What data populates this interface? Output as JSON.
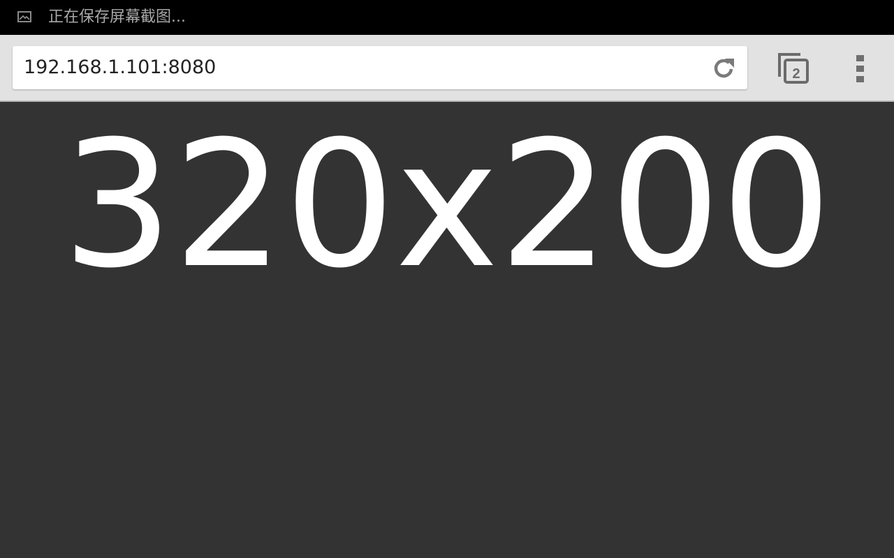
{
  "status_bar": {
    "notification_icon": "image-icon",
    "notification_text": "正在保存屏幕截图..."
  },
  "toolbar": {
    "url": "192.168.1.101:8080",
    "reload_icon": "reload-icon",
    "tab_count": "2",
    "menu_icon": "overflow-menu-icon"
  },
  "page": {
    "resolution_text": "320x200"
  },
  "colors": {
    "status_bar_bg": "#000000",
    "toolbar_bg": "#e2e2e2",
    "content_bg": "#333333",
    "content_text": "#ffffff"
  }
}
